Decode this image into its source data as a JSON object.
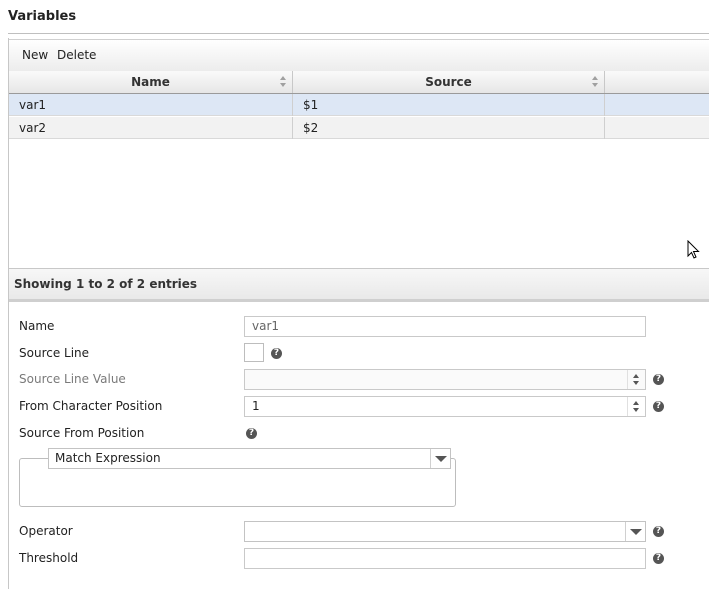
{
  "section": {
    "title": "Variables"
  },
  "toolbar": {
    "new_label": "New",
    "delete_label": "Delete"
  },
  "grid": {
    "columns": [
      "Name",
      "Source"
    ],
    "rows": [
      {
        "name": "var1",
        "source": "$1",
        "selected": true
      },
      {
        "name": "var2",
        "source": "$2",
        "selected": false
      }
    ],
    "info": "Showing 1 to 2 of 2 entries"
  },
  "form": {
    "name_label": "Name",
    "name_value": "var1",
    "source_line_label": "Source Line",
    "source_line_checked": false,
    "source_line_value_label": "Source Line Value",
    "source_line_value": "",
    "from_char_pos_label": "From Character Position",
    "from_char_pos_value": "1",
    "source_from_position_label": "Source From Position",
    "match_mode": "Match Expression",
    "operator_label": "Operator",
    "operator_value": "",
    "threshold_label": "Threshold",
    "threshold_value": ""
  },
  "icons": {
    "help": "help-icon",
    "sort": "sort-icon",
    "cursor": "mouse-cursor-icon"
  },
  "colors": {
    "selected_row": "#dde7f5",
    "alt_row": "#f2f2f2"
  }
}
